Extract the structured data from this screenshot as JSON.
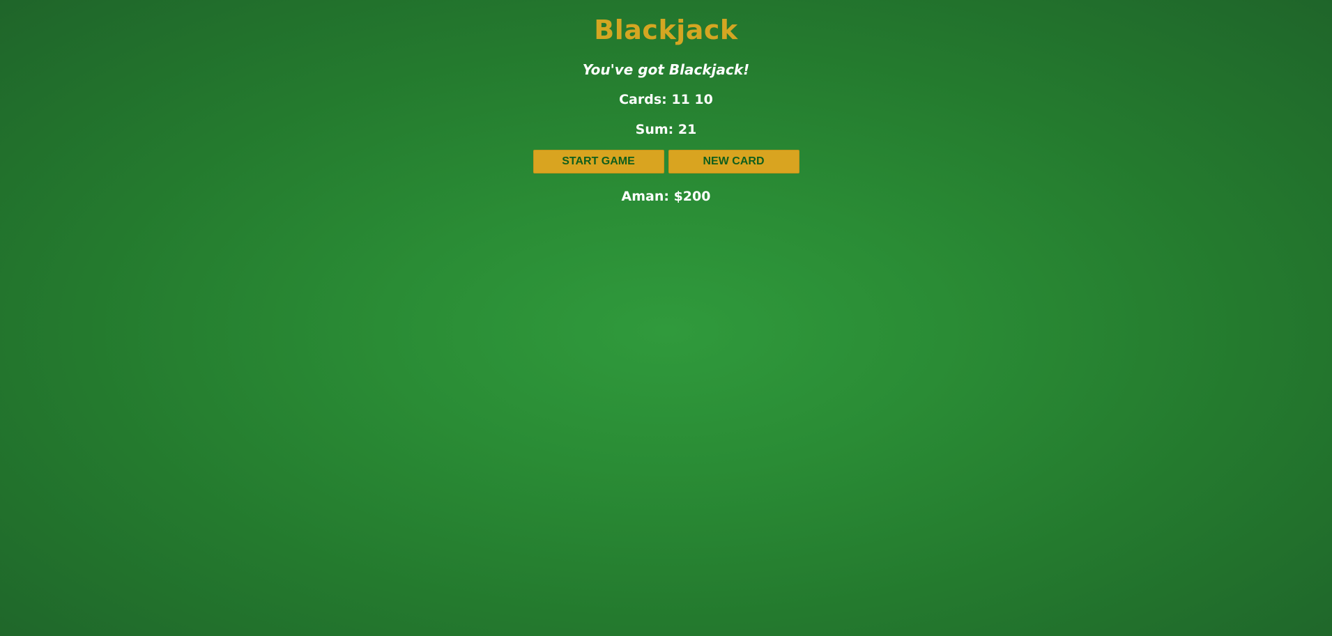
{
  "game": {
    "title": "Blackjack",
    "message": "You've got Blackjack!",
    "cards_text": "Cards: 11 10",
    "sum_text": "Sum: 21",
    "player_text": "Aman: $200"
  },
  "controls": {
    "start_label": "START GAME",
    "new_card_label": "NEW CARD"
  },
  "colors": {
    "felt": "#2a8c35",
    "gold": "#d9a420",
    "button_text": "#0f5e1c",
    "text": "#ffffff"
  }
}
